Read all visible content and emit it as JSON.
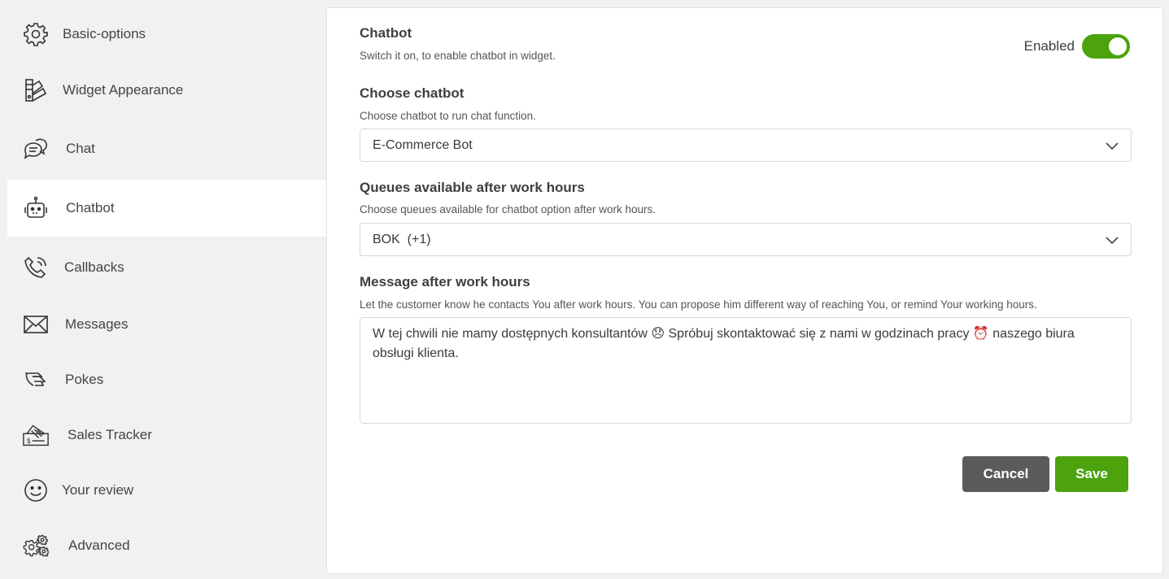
{
  "sidebar": {
    "items": [
      {
        "label": "Basic-options",
        "icon": "gear-icon"
      },
      {
        "label": "Widget Appearance",
        "icon": "palette-icon"
      },
      {
        "label": "Chat",
        "icon": "chat-bubbles-icon"
      },
      {
        "label": "Chatbot",
        "icon": "robot-icon"
      },
      {
        "label": "Callbacks",
        "icon": "phone-icon"
      },
      {
        "label": "Messages",
        "icon": "envelope-icon"
      },
      {
        "label": "Pokes",
        "icon": "hand-icon"
      },
      {
        "label": "Sales Tracker",
        "icon": "money-tag-icon"
      },
      {
        "label": "Your review",
        "icon": "smiley-icon"
      },
      {
        "label": "Advanced",
        "icon": "gears-icon"
      }
    ],
    "active": "Chatbot"
  },
  "chatbot": {
    "title": "Chatbot",
    "desc": "Switch it on, to enable chatbot in widget.",
    "toggle_label": "Enabled",
    "enabled": true
  },
  "choose": {
    "title": "Choose chatbot",
    "desc": "Choose chatbot to run chat function.",
    "value": "E-Commerce Bot"
  },
  "queues": {
    "title": "Queues available after work hours",
    "desc": "Choose queues available for chatbot option after work hours.",
    "value": "BOK  (+1)"
  },
  "message": {
    "title": "Message after work hours",
    "desc": "Let the customer know he contacts You after work hours. You can propose him different way of reaching You, or remind Your working hours.",
    "value": "W tej chwili nie mamy dostępnych konsultantów 😞 Spróbuj skontaktować się z nami w godzinach pracy ⏰ naszego biura obsługi klienta."
  },
  "buttons": {
    "cancel": "Cancel",
    "save": "Save"
  },
  "colors": {
    "accent": "#4ca30d",
    "cancel": "#5b5b5b"
  }
}
